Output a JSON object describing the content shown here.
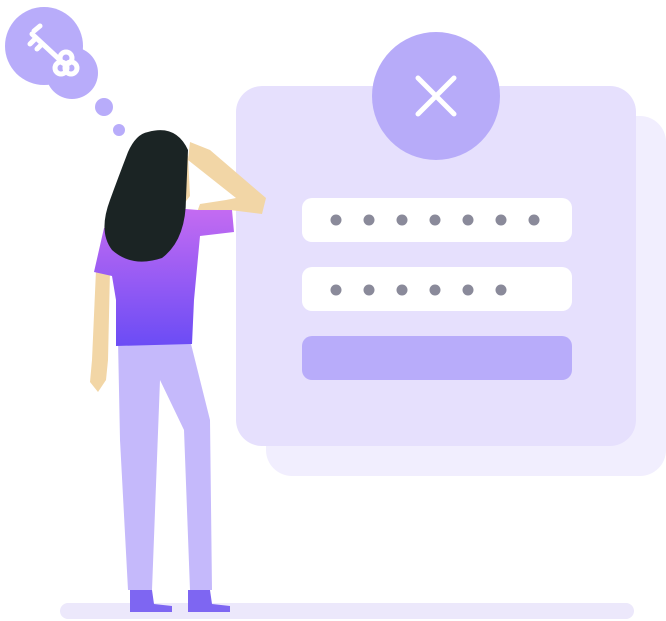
{
  "scene": {
    "description_visible_text": "",
    "colors": {
      "background": "#ffffff",
      "card_back": "#f1eefe",
      "card_front": "#e6e0fd",
      "field": "#ffffff",
      "dot": "#8a8a9a",
      "submit": "#b8acfa",
      "error_circle": "#b7abf9",
      "error_x": "#ffffff",
      "thought_bubble": "#b8acfa",
      "key": "#ffffff",
      "ground": "#ece8fb",
      "hair": "#1b2424",
      "skin": "#f2d6a6",
      "shirt_top": "#c66cf2",
      "shirt_bottom": "#6b4cf5",
      "pants": "#c5b9fb",
      "shoes": "#7e66f2"
    },
    "login_card": {
      "password_field_1_dots": 7,
      "password_field_2_dots": 6
    },
    "icons": {
      "error": "close-x-icon",
      "thought": "key-icon"
    }
  }
}
